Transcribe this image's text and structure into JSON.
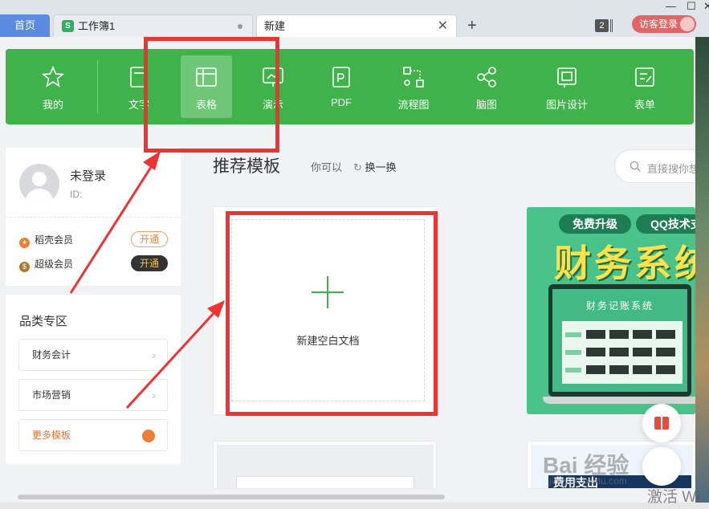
{
  "tabs": {
    "home_label": "首页",
    "tab1_label": "工作簿1",
    "tab1_icon": "S",
    "tab2_label": "新建",
    "new_tab": "+",
    "tab_count": "2",
    "login_label": "访客登录"
  },
  "toolbar": {
    "items": [
      {
        "label": "我的",
        "icon": "star-icon"
      },
      {
        "label": "文字",
        "icon": "document-icon"
      },
      {
        "label": "表格",
        "icon": "table-icon",
        "active": true
      },
      {
        "label": "演示",
        "icon": "presentation-icon"
      },
      {
        "label": "PDF",
        "icon": "pdf-icon"
      },
      {
        "label": "流程图",
        "icon": "flowchart-icon"
      },
      {
        "label": "脑图",
        "icon": "mindmap-icon"
      },
      {
        "label": "图片设计",
        "icon": "image-design-icon"
      },
      {
        "label": "表单",
        "icon": "form-icon"
      }
    ],
    "accent": "#3fb34a"
  },
  "profile": {
    "name": "未登录",
    "id_label": "ID:",
    "member1": "稻壳会员",
    "member1_btn": "开通",
    "member2": "超级会员",
    "member2_btn": "开通"
  },
  "category": {
    "title": "品类专区",
    "items": [
      "财务会计",
      "市场营销"
    ],
    "more": "更多模板"
  },
  "main": {
    "title": "推荐模板",
    "sub": "你可以",
    "refresh": "换一换",
    "search_placeholder": "直接搜你想",
    "blank_label": "新建空白文档"
  },
  "finance_card": {
    "pill1": "免费升级",
    "pill2": "QQ技术支",
    "big": "财务系统",
    "screen_title": "财务记账系统"
  },
  "bottom_card": {
    "band": "费用支出"
  },
  "watermark": {
    "text": "Bai 经验",
    "sub": "jingyan.baidu.com",
    "activate": "激活 Wi"
  }
}
